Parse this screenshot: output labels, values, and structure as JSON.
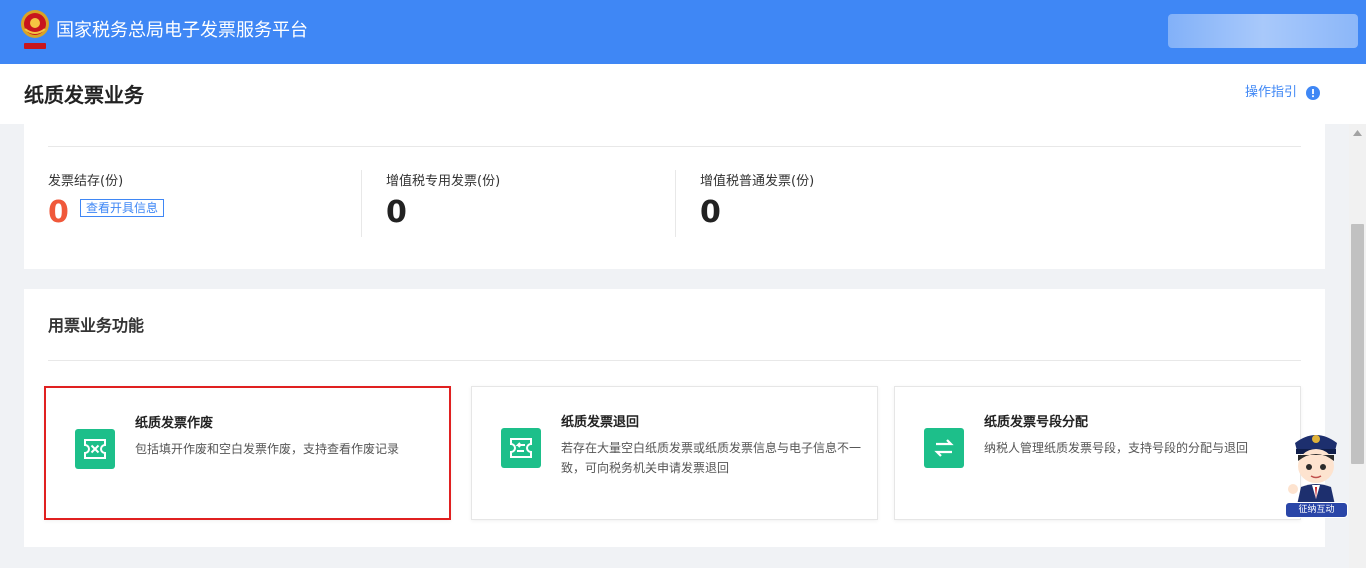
{
  "header": {
    "title": "国家税务总局电子发票服务平台",
    "user_area": "",
    "colors": {
      "brand_blue": "#3f87f5"
    }
  },
  "page": {
    "title": "纸质发票业务",
    "guide_label": "操作指引",
    "guide_icon": "info-icon"
  },
  "stats": [
    {
      "label": "发票结存(份)",
      "value": "0",
      "value_color": "#f0583a",
      "link_label": "查看开具信息"
    },
    {
      "label": "增值税专用发票(份)",
      "value": "0"
    },
    {
      "label": "增值税普通发票(份)",
      "value": "0"
    }
  ],
  "functions": {
    "section_title": "用票业务功能",
    "items": [
      {
        "title": "纸质发票作废",
        "desc": "包括填开作废和空白发票作废，支持查看作废记录",
        "icon": "void-ticket-icon",
        "selected": true
      },
      {
        "title": "纸质发票退回",
        "desc": "若存在大量空白纸质发票或纸质发票信息与电子信息不一致，可向税务机关申请发票退回",
        "icon": "return-ticket-icon",
        "selected": false
      },
      {
        "title": "纸质发票号段分配",
        "desc": "纳税人管理纸质发票号段，支持号段的分配与退回",
        "icon": "swap-arrows-icon",
        "selected": false
      }
    ],
    "accent_color": "#1dbf8a"
  },
  "assistant": {
    "label": "征纳互动"
  }
}
